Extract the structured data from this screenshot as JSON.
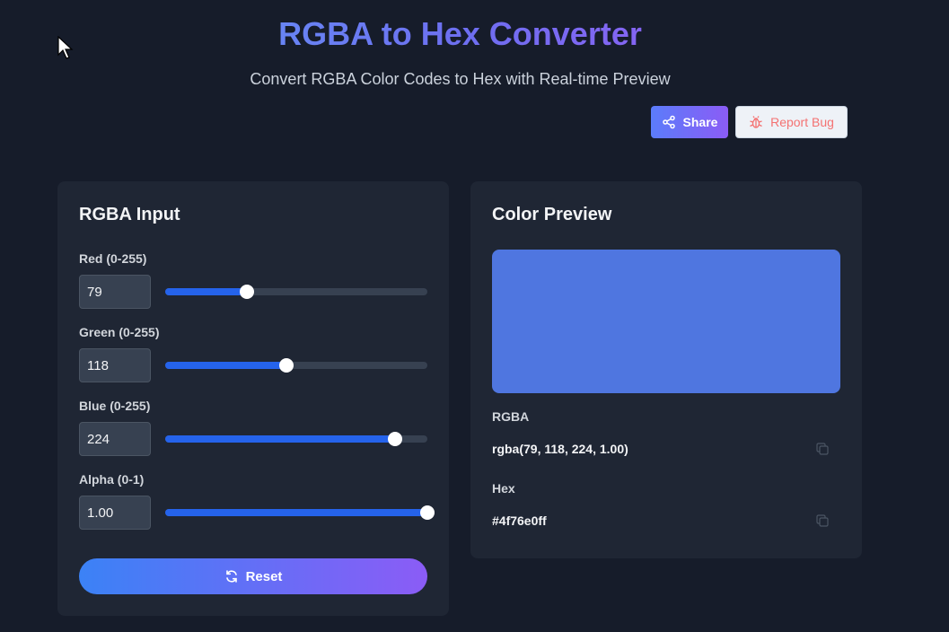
{
  "header": {
    "title": "RGBA to Hex Converter",
    "subtitle": "Convert RGBA Color Codes to Hex with Real-time Preview"
  },
  "actions": {
    "share_label": "Share",
    "share_icon": "share-icon",
    "bug_label": "Report Bug",
    "bug_icon": "bug-icon"
  },
  "input_panel": {
    "title": "RGBA Input",
    "channels": [
      {
        "label": "Red (0-255)",
        "value": "79",
        "fraction": 0.31
      },
      {
        "label": "Green (0-255)",
        "value": "118",
        "fraction": 0.463
      },
      {
        "label": "Blue (0-255)",
        "value": "224",
        "fraction": 0.878
      },
      {
        "label": "Alpha (0-1)",
        "value": "1.00",
        "fraction": 1.0
      }
    ],
    "reset_label": "Reset",
    "reset_icon": "refresh-icon"
  },
  "preview_panel": {
    "title": "Color Preview",
    "swatch_color": "#4f76e0",
    "rgba_label": "RGBA",
    "rgba_value": "rgba(79, 118, 224, 1.00)",
    "hex_label": "Hex",
    "hex_value": "#4f76e0ff",
    "copy_icon": "copy-icon"
  },
  "colors": {
    "accent": "#2563eb",
    "background": "#161c2a",
    "card": "#1f2634",
    "bug_text": "#f47272"
  }
}
